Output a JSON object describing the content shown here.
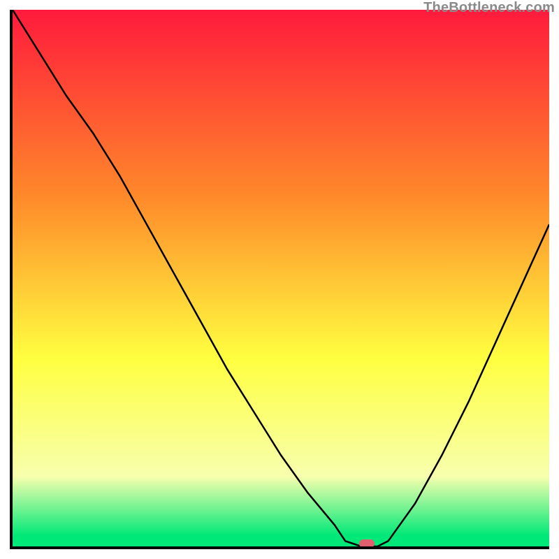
{
  "watermark": "TheBottleneck.com",
  "colors": {
    "red": "#ff1a3c",
    "orange": "#ffb030",
    "yellow": "#ffff40",
    "paleyellow": "#faffb0",
    "green": "#00e878",
    "border": "#000000",
    "marker": "#e06070"
  },
  "chart_data": {
    "type": "line",
    "title": "",
    "xlabel": "",
    "ylabel": "",
    "xlim": [
      0,
      100
    ],
    "ylim": [
      0,
      100
    ],
    "x": [
      0,
      5,
      10,
      15,
      20,
      25,
      30,
      35,
      40,
      45,
      50,
      55,
      60,
      62,
      65,
      68,
      70,
      75,
      80,
      85,
      90,
      95,
      100
    ],
    "values": [
      100,
      92,
      84,
      77,
      69,
      60,
      51,
      42,
      33,
      25,
      17,
      10,
      4,
      1,
      0,
      0,
      1,
      8,
      17,
      27,
      38,
      49,
      60
    ],
    "gradient_stops": [
      {
        "pct": 0,
        "color": "#ff1a3c"
      },
      {
        "pct": 35,
        "color": "#ff8a2a"
      },
      {
        "pct": 65,
        "color": "#ffff40"
      },
      {
        "pct": 87,
        "color": "#f7ffae"
      },
      {
        "pct": 98,
        "color": "#00e878"
      },
      {
        "pct": 100,
        "color": "#00e878"
      }
    ],
    "marker": {
      "x": 66,
      "y": 0
    }
  }
}
